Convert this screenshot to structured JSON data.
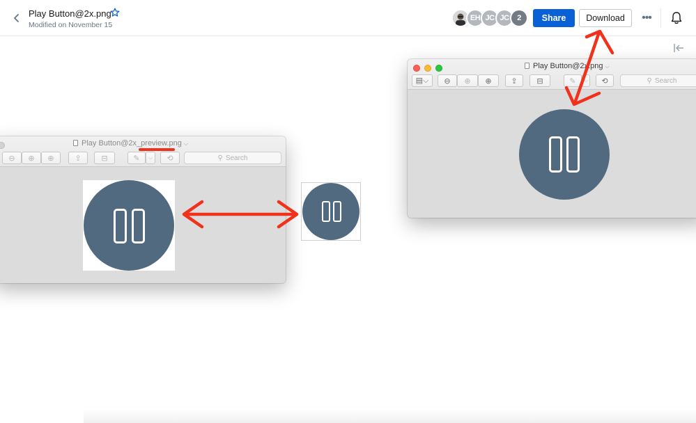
{
  "header": {
    "title": "Play Button@2x.png",
    "modified": "Modified on November 15",
    "avatars": [
      {
        "label": ""
      },
      {
        "label": "EH"
      },
      {
        "label": "JC"
      },
      {
        "label": "JC"
      },
      {
        "label": "2"
      }
    ],
    "share_label": "Share",
    "download_label": "Download",
    "more_label": "•••"
  },
  "left_window": {
    "title": "Play Button@2x_preview.png",
    "search_placeholder": "Search"
  },
  "right_window": {
    "title": "Play Button@2x.png",
    "search_placeholder": "Search"
  },
  "colors": {
    "accent": "#0a61d6",
    "icon_fill": "#526a80",
    "annotation": "#f0311b",
    "star": "#0a61d6"
  }
}
